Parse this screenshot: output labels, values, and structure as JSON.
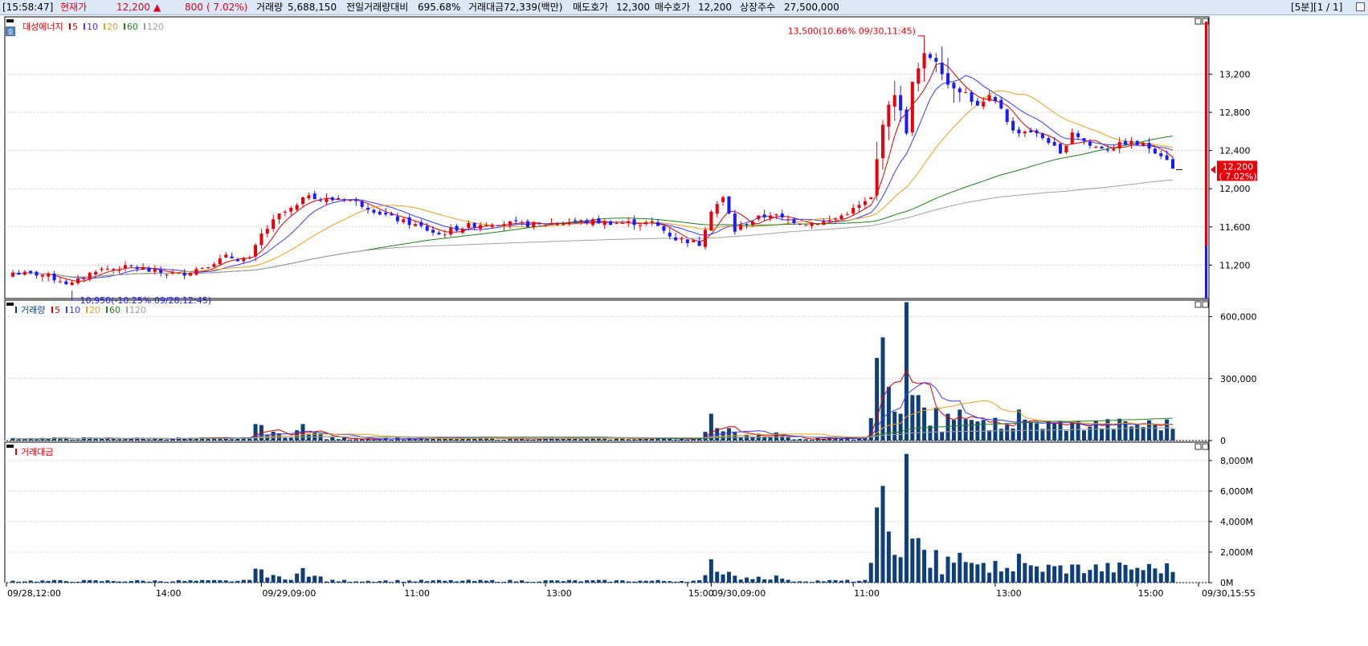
{
  "header": {
    "time": "[15:58:47]",
    "price_label": "현재가",
    "price": "12,200",
    "change_arrow": "▲",
    "change": "800",
    "change_pct": "( 7.02%)",
    "volume_label": "거래량",
    "volume": "5,688,150",
    "prev_volume_ratio_label": "전일거래량대비",
    "prev_volume_ratio": "695.68%",
    "turnover_label": "거래대금",
    "turnover": "72,339(백만)",
    "ask_label": "매도호가",
    "ask": "12,300",
    "bid_label": "매수호가",
    "bid": "12,200",
    "shares_label": "상장주수",
    "shares": "27,500,000",
    "period": "[5분][1 / 1]",
    "window_icon": "restore-icon"
  },
  "colors": {
    "up": "#e8000b",
    "down": "#1a1aff",
    "ma5": "#e00000",
    "ma10": "#3a3aff",
    "ma20": "#e8a020",
    "ma60": "#208020",
    "ma120": "#a0a0a0",
    "volume_bar": "#0f3f7a"
  },
  "chart_data": [
    {
      "type": "candlestick",
      "title": "대성에너지",
      "legend": [
        "5",
        "10",
        "20",
        "60",
        "120"
      ],
      "legend_prefix_icon": "ho-icon",
      "y_ticks": [
        "13,200",
        "12,800",
        "12,400",
        "12,000",
        "11,600",
        "11,200"
      ],
      "y_tick_values": [
        13200,
        12800,
        12400,
        12000,
        11600,
        11200
      ],
      "ylim": [
        10850,
        13800
      ],
      "current_price_label": "12,200",
      "current_price_pct": "( 7.02%)",
      "current_price": 12200,
      "high_annotation": "13,500(10.66% 09/30,11:45)",
      "low_annotation": "10,950(-10.25% 09/28,12:45)",
      "high": 13500,
      "low": 10950,
      "x_labels": [
        "09/28,12:00",
        "14:00",
        "09/29,09:00",
        "11:00",
        "13:00",
        "15:00",
        "09/30,09:00",
        "11:00",
        "13:00",
        "15:00",
        "09/30,15:55"
      ],
      "x_label_index": [
        0,
        24,
        42,
        66,
        90,
        114,
        118,
        142,
        166,
        190,
        201
      ],
      "candle_count": 197,
      "ohlc_keypoints": [
        [
          0,
          11120
        ],
        [
          5,
          11100
        ],
        [
          10,
          11000
        ],
        [
          14,
          11150
        ],
        [
          20,
          11180
        ],
        [
          24,
          11130
        ],
        [
          28,
          11100
        ],
        [
          32,
          11180
        ],
        [
          36,
          11280
        ],
        [
          40,
          11260
        ],
        [
          42,
          11520
        ],
        [
          45,
          11720
        ],
        [
          48,
          11820
        ],
        [
          50,
          11950
        ],
        [
          52,
          11880
        ],
        [
          56,
          11900
        ],
        [
          60,
          11810
        ],
        [
          64,
          11690
        ],
        [
          68,
          11620
        ],
        [
          72,
          11520
        ],
        [
          76,
          11600
        ],
        [
          80,
          11640
        ],
        [
          84,
          11640
        ],
        [
          88,
          11620
        ],
        [
          92,
          11650
        ],
        [
          96,
          11660
        ],
        [
          100,
          11650
        ],
        [
          104,
          11640
        ],
        [
          108,
          11640
        ],
        [
          112,
          11480
        ],
        [
          116,
          11420
        ],
        [
          118,
          11780
        ],
        [
          120,
          11900
        ],
        [
          122,
          11560
        ],
        [
          124,
          11640
        ],
        [
          128,
          11740
        ],
        [
          130,
          11680
        ],
        [
          134,
          11640
        ],
        [
          138,
          11660
        ],
        [
          142,
          11780
        ],
        [
          145,
          11900
        ],
        [
          147,
          12700
        ],
        [
          149,
          13000
        ],
        [
          151,
          12600
        ],
        [
          152,
          13100
        ],
        [
          154,
          13400
        ],
        [
          156,
          13350
        ],
        [
          158,
          13100
        ],
        [
          161,
          13000
        ],
        [
          163,
          12850
        ],
        [
          165,
          12950
        ],
        [
          167,
          12850
        ],
        [
          169,
          12600
        ],
        [
          172,
          12600
        ],
        [
          175,
          12500
        ],
        [
          177,
          12350
        ],
        [
          179,
          12600
        ],
        [
          182,
          12450
        ],
        [
          185,
          12420
        ],
        [
          188,
          12480
        ],
        [
          191,
          12460
        ],
        [
          193,
          12400
        ],
        [
          195,
          12320
        ],
        [
          196,
          12200
        ]
      ]
    },
    {
      "type": "bar",
      "title": "거래량",
      "legend": [
        "5",
        "10",
        "20",
        "60",
        "120"
      ],
      "y_ticks": [
        "600,000",
        "300,000",
        "0"
      ],
      "y_tick_values": [
        600000,
        300000,
        0
      ],
      "ylim": [
        0,
        680000
      ],
      "spikes": [
        [
          41,
          80000
        ],
        [
          42,
          75000
        ],
        [
          48,
          50000
        ],
        [
          49,
          80000
        ],
        [
          118,
          130000
        ],
        [
          119,
          60000
        ],
        [
          120,
          45000
        ],
        [
          121,
          60000
        ],
        [
          146,
          400000
        ],
        [
          147,
          500000
        ],
        [
          148,
          260000
        ],
        [
          149,
          140000
        ],
        [
          150,
          130000
        ],
        [
          151,
          670000
        ],
        [
          152,
          220000
        ],
        [
          153,
          220000
        ],
        [
          154,
          160000
        ],
        [
          156,
          160000
        ],
        [
          158,
          130000
        ],
        [
          160,
          150000
        ],
        [
          162,
          100000
        ],
        [
          164,
          100000
        ],
        [
          166,
          110000
        ],
        [
          170,
          150000
        ]
      ]
    },
    {
      "type": "bar",
      "title": "거래대금",
      "y_ticks": [
        "8,000M",
        "6,000M",
        "4,000M",
        "2,000M",
        "0M"
      ],
      "y_tick_values": [
        8000,
        6000,
        4000,
        2000,
        0
      ],
      "ylim": [
        0,
        9200
      ],
      "unit": "백만"
    }
  ]
}
